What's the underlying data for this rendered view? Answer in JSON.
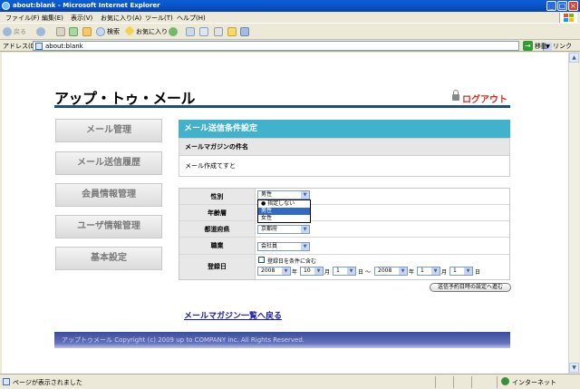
{
  "window": {
    "title": "about:blank - Microsoft Internet Explorer"
  },
  "menu": {
    "items": [
      "ファイル(F)",
      "編集(E)",
      "表示(V)",
      "お気に入り(A)",
      "ツール(T)",
      "ヘルプ(H)"
    ]
  },
  "toolbar": {
    "back_label": "戻る",
    "search_label": "検索",
    "favorites_label": "お気に入り"
  },
  "address": {
    "label": "アドレス(D)",
    "value": "about:blank",
    "go_label": "移動",
    "links_label": "リンク"
  },
  "page": {
    "logo": "アップ・トゥ・メール",
    "logout_label": "ログアウト",
    "nav": [
      "メール管理",
      "メール送信履歴",
      "会員情報管理",
      "ユーザ情報管理",
      "基本設定"
    ],
    "section_title": "メール送信条件設定",
    "magazine_subject_label": "メールマガジンの件名",
    "magazine_subject_value": "メール作成てすと",
    "form": {
      "gender_label": "性別",
      "gender_selected": "男性",
      "gender_options": [
        "指定しない",
        "男性",
        "女性"
      ],
      "gender_highlighted": "男性",
      "age_label": "年齢層",
      "prefecture_label": "都道府県",
      "prefecture_value": "京都府",
      "job_label": "職業",
      "job_value": "会社員",
      "regdate_label": "登録日",
      "regdate_checkbox_label": "登録日を条件に含む",
      "from_year": "2008",
      "from_month": "10",
      "from_day": "1",
      "to_year": "2008",
      "to_month": "1",
      "to_day": "1",
      "year_unit": "年",
      "month_unit": "月",
      "day_unit": "日",
      "range_sep": "～"
    },
    "schedule_button": "送信予約日時の設定へ進む",
    "back_link": "メールマガジン一覧へ戻る",
    "footer": "アップトゥメール Copyright (c) 2009 up to COMPANY inc. All Rights Reserved."
  },
  "status": {
    "text": "ページが表示されました",
    "zone": "インターネット"
  },
  "colors": {
    "section_header": "#41b1cc",
    "logout": "#d42a18",
    "title_bar": "#0b4fc5",
    "footer": "#3b4c9b"
  }
}
